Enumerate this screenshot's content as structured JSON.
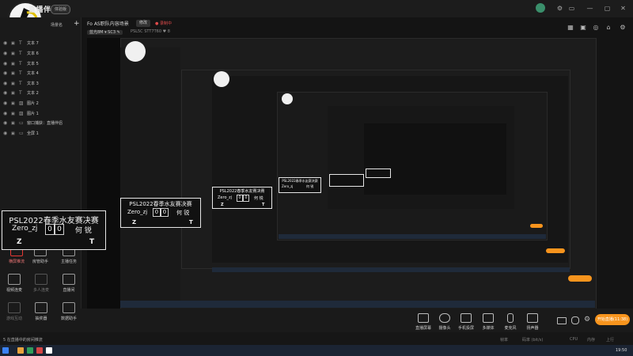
{
  "app": {
    "brand": "直播伴侣",
    "version_badge": "体验版"
  },
  "window_controls": [
    "⚙",
    "▭",
    "—",
    "▢",
    "✕"
  ],
  "sidebar": {
    "scene_label": "场景名",
    "add_symbol": "+",
    "sources": [
      {
        "label": "文本 7"
      },
      {
        "label": "文本 6"
      },
      {
        "label": "文本 5"
      },
      {
        "label": "文本 4"
      },
      {
        "label": "文本 3"
      },
      {
        "label": "文本 2"
      },
      {
        "label": "图片 2"
      },
      {
        "label": "图片 1"
      },
      {
        "label": "窗口捕获：直播伴侣"
      },
      {
        "label": "全屏 1"
      }
    ],
    "tools": [
      {
        "label": "横屏推流",
        "icon": "landscape-icon"
      },
      {
        "label": "房管助手",
        "icon": "admin-icon"
      },
      {
        "label": "主播任务",
        "icon": "task-icon"
      },
      {
        "label": "视频连麦",
        "icon": "video-link-icon"
      },
      {
        "label": "多人连麦",
        "icon": "multi-link-icon"
      },
      {
        "label": "直播间",
        "icon": "live-room-icon"
      },
      {
        "label": "游戏互动",
        "icon": "game-icon"
      },
      {
        "label": "抽奖器",
        "icon": "lottery-icon"
      },
      {
        "label": "数据助手",
        "icon": "data-icon"
      }
    ]
  },
  "header": {
    "scene_info": "Fo AS职队内容场景",
    "switch_btn": "修改",
    "rec_status": "● 录制中",
    "quality": "蓝光8M ▾ SC3 ✎",
    "detail": "PSL5C   STT7T60   ♥ 8",
    "icons": [
      "layout-icon",
      "lock-icon",
      "camera-icon",
      "share-icon",
      "settings-icon"
    ]
  },
  "scoreboard": {
    "title": "PSL2022春季水友赛决赛",
    "left_player": "Zero_zj",
    "score_left": "0",
    "score_right": "0",
    "right_player": "何 锐",
    "left_side": "Z",
    "right_side": "T"
  },
  "toolbar": {
    "items": [
      {
        "label": "直播屏幕",
        "icon": "screen-icon"
      },
      {
        "label": "摄像头",
        "icon": "camera-icon"
      },
      {
        "label": "手机投屏",
        "icon": "phone-cast-icon"
      },
      {
        "label": "多媒体",
        "icon": "media-icon"
      },
      {
        "label": "麦克风",
        "icon": "mic-icon"
      },
      {
        "label": "扬声器",
        "icon": "speaker-icon"
      }
    ],
    "go_live": "开始直播(11:38)"
  },
  "statusbar": {
    "left": "5 在直播中的房间推流",
    "items": [
      "帧率",
      "码率 (bit/s)",
      "CPU",
      "内存",
      "上行"
    ],
    "time": "19:50"
  },
  "colors": {
    "accent": "#f7941d",
    "danger": "#e53935",
    "blue": "#3b82f6"
  }
}
